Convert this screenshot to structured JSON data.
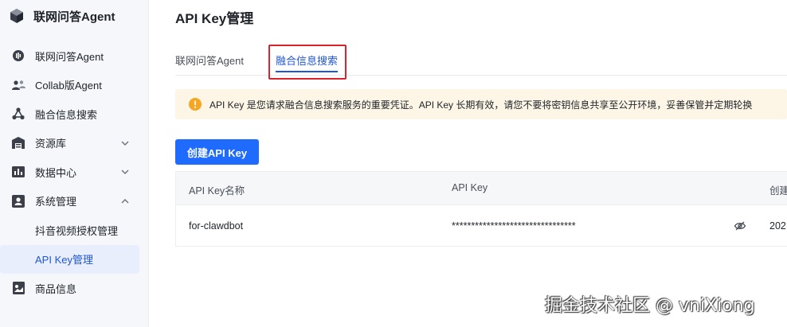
{
  "sidebar": {
    "brand_title": "联网问答Agent",
    "items": [
      {
        "label": "联网问答Agent",
        "icon": "chat-bubble-icon"
      },
      {
        "label": "Collab版Agent",
        "icon": "users-icon"
      },
      {
        "label": "融合信息搜索",
        "icon": "network-icon"
      },
      {
        "label": "资源库",
        "icon": "warehouse-icon",
        "expandable": true,
        "expanded": false
      },
      {
        "label": "数据中心",
        "icon": "dashboard-icon",
        "expandable": true,
        "expanded": false
      },
      {
        "label": "系统管理",
        "icon": "profile-icon",
        "expandable": true,
        "expanded": true
      }
    ],
    "sub_items": [
      {
        "label": "抖音视频授权管理",
        "active": false
      },
      {
        "label": "API Key管理",
        "active": true
      }
    ],
    "last_item": {
      "label": "商品信息",
      "icon": "product-icon"
    }
  },
  "main": {
    "page_title": "API Key管理",
    "tabs": [
      {
        "label": "联网问答Agent",
        "active": false
      },
      {
        "label": "融合信息搜索",
        "active": true
      }
    ],
    "alert": "API Key 是您请求融合信息搜索服务的重要凭证。API Key 长期有效，请您不要将密钥信息共享至公开环境，妥善保管并定期轮换",
    "create_button": "创建API Key",
    "table": {
      "headers": [
        "API Key名称",
        "API Key",
        "创建"
      ],
      "rows": [
        {
          "name": "for-clawdbot",
          "key": "********************************",
          "created": "202"
        }
      ]
    }
  },
  "watermark": "掘金技术社区 @ vniXiong",
  "colors": {
    "accent": "#1f6bff",
    "active_text": "#1f56d8",
    "highlight_border": "#d9232d",
    "alert_bg": "#fdf6e6",
    "warning": "#f5a623"
  }
}
